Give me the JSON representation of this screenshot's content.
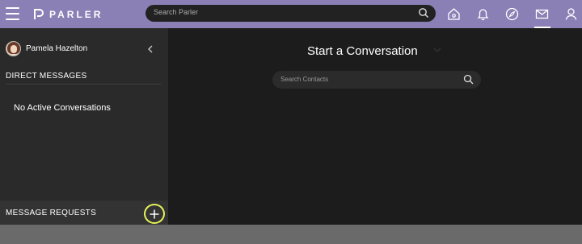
{
  "header": {
    "brand": "PARLER",
    "search_placeholder": "Search Parler",
    "nav": [
      "home-icon",
      "bell-icon",
      "compass-icon",
      "mail-icon",
      "user-icon"
    ],
    "active_nav": "mail-icon",
    "accent_color": "#8b80b6"
  },
  "sidebar": {
    "user_name": "Pamela Hazelton",
    "dm_heading": "DIRECT MESSAGES",
    "empty_state": "No Active Conversations",
    "requests_label": "MESSAGE REQUESTS",
    "add_button_icon": "plus-icon",
    "add_button_ring_color": "#e6f25a"
  },
  "main": {
    "title": "Start a Conversation",
    "search_placeholder": "Search Contacts"
  }
}
